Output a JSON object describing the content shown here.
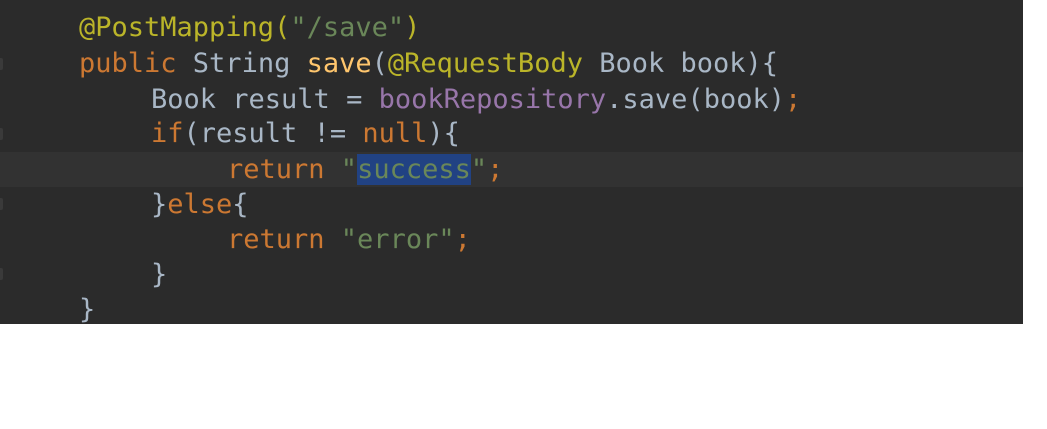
{
  "code": {
    "lines": [
      {
        "parts": [
          {
            "t": "@PostMapping(",
            "c": "ann"
          },
          {
            "t": "\"/save\"",
            "c": "str"
          },
          {
            "t": ")",
            "c": "ann"
          }
        ]
      },
      {
        "parts": [
          {
            "t": "public ",
            "c": "kw"
          },
          {
            "t": "String ",
            "c": "txt"
          },
          {
            "t": "save",
            "c": "fn"
          },
          {
            "t": "(",
            "c": "txt"
          },
          {
            "t": "@RequestBody ",
            "c": "ann"
          },
          {
            "t": "Book book){",
            "c": "txt"
          }
        ]
      },
      {
        "parts": [
          {
            "t": "Book result = ",
            "c": "txt"
          },
          {
            "t": "bookRepository",
            "c": "fld"
          },
          {
            "t": ".save(book)",
            "c": "txt"
          },
          {
            "t": ";",
            "c": "kw"
          }
        ]
      },
      {
        "parts": [
          {
            "t": "if",
            "c": "kw"
          },
          {
            "t": "(result != ",
            "c": "txt"
          },
          {
            "t": "null",
            "c": "kw"
          },
          {
            "t": "){",
            "c": "txt"
          }
        ]
      },
      {
        "parts": [
          {
            "t": "return ",
            "c": "kw"
          },
          {
            "t": "\"",
            "c": "str"
          },
          {
            "t": "success",
            "c": "sel"
          },
          {
            "t": "\"",
            "c": "str"
          },
          {
            "t": ";",
            "c": "kw"
          }
        ]
      },
      {
        "parts": [
          {
            "t": "}",
            "c": "txt"
          },
          {
            "t": "else",
            "c": "kw"
          },
          {
            "t": "{",
            "c": "txt"
          }
        ]
      },
      {
        "parts": [
          {
            "t": "return ",
            "c": "kw"
          },
          {
            "t": "\"error\"",
            "c": "str"
          },
          {
            "t": ";",
            "c": "kw"
          }
        ]
      },
      {
        "parts": [
          {
            "t": "}",
            "c": "txt"
          }
        ]
      },
      {
        "parts": [
          {
            "t": "}",
            "c": "txt"
          }
        ]
      }
    ]
  },
  "gutter": {
    "intention_icon": "lightbulb-icon"
  },
  "colors": {
    "background": "#2b2b2b",
    "annotation": "#bbb529",
    "string": "#6a8759",
    "keyword": "#cc7832",
    "method": "#ffc66d",
    "field": "#9876aa",
    "selection": "#214283",
    "text": "#a9b7c6"
  }
}
